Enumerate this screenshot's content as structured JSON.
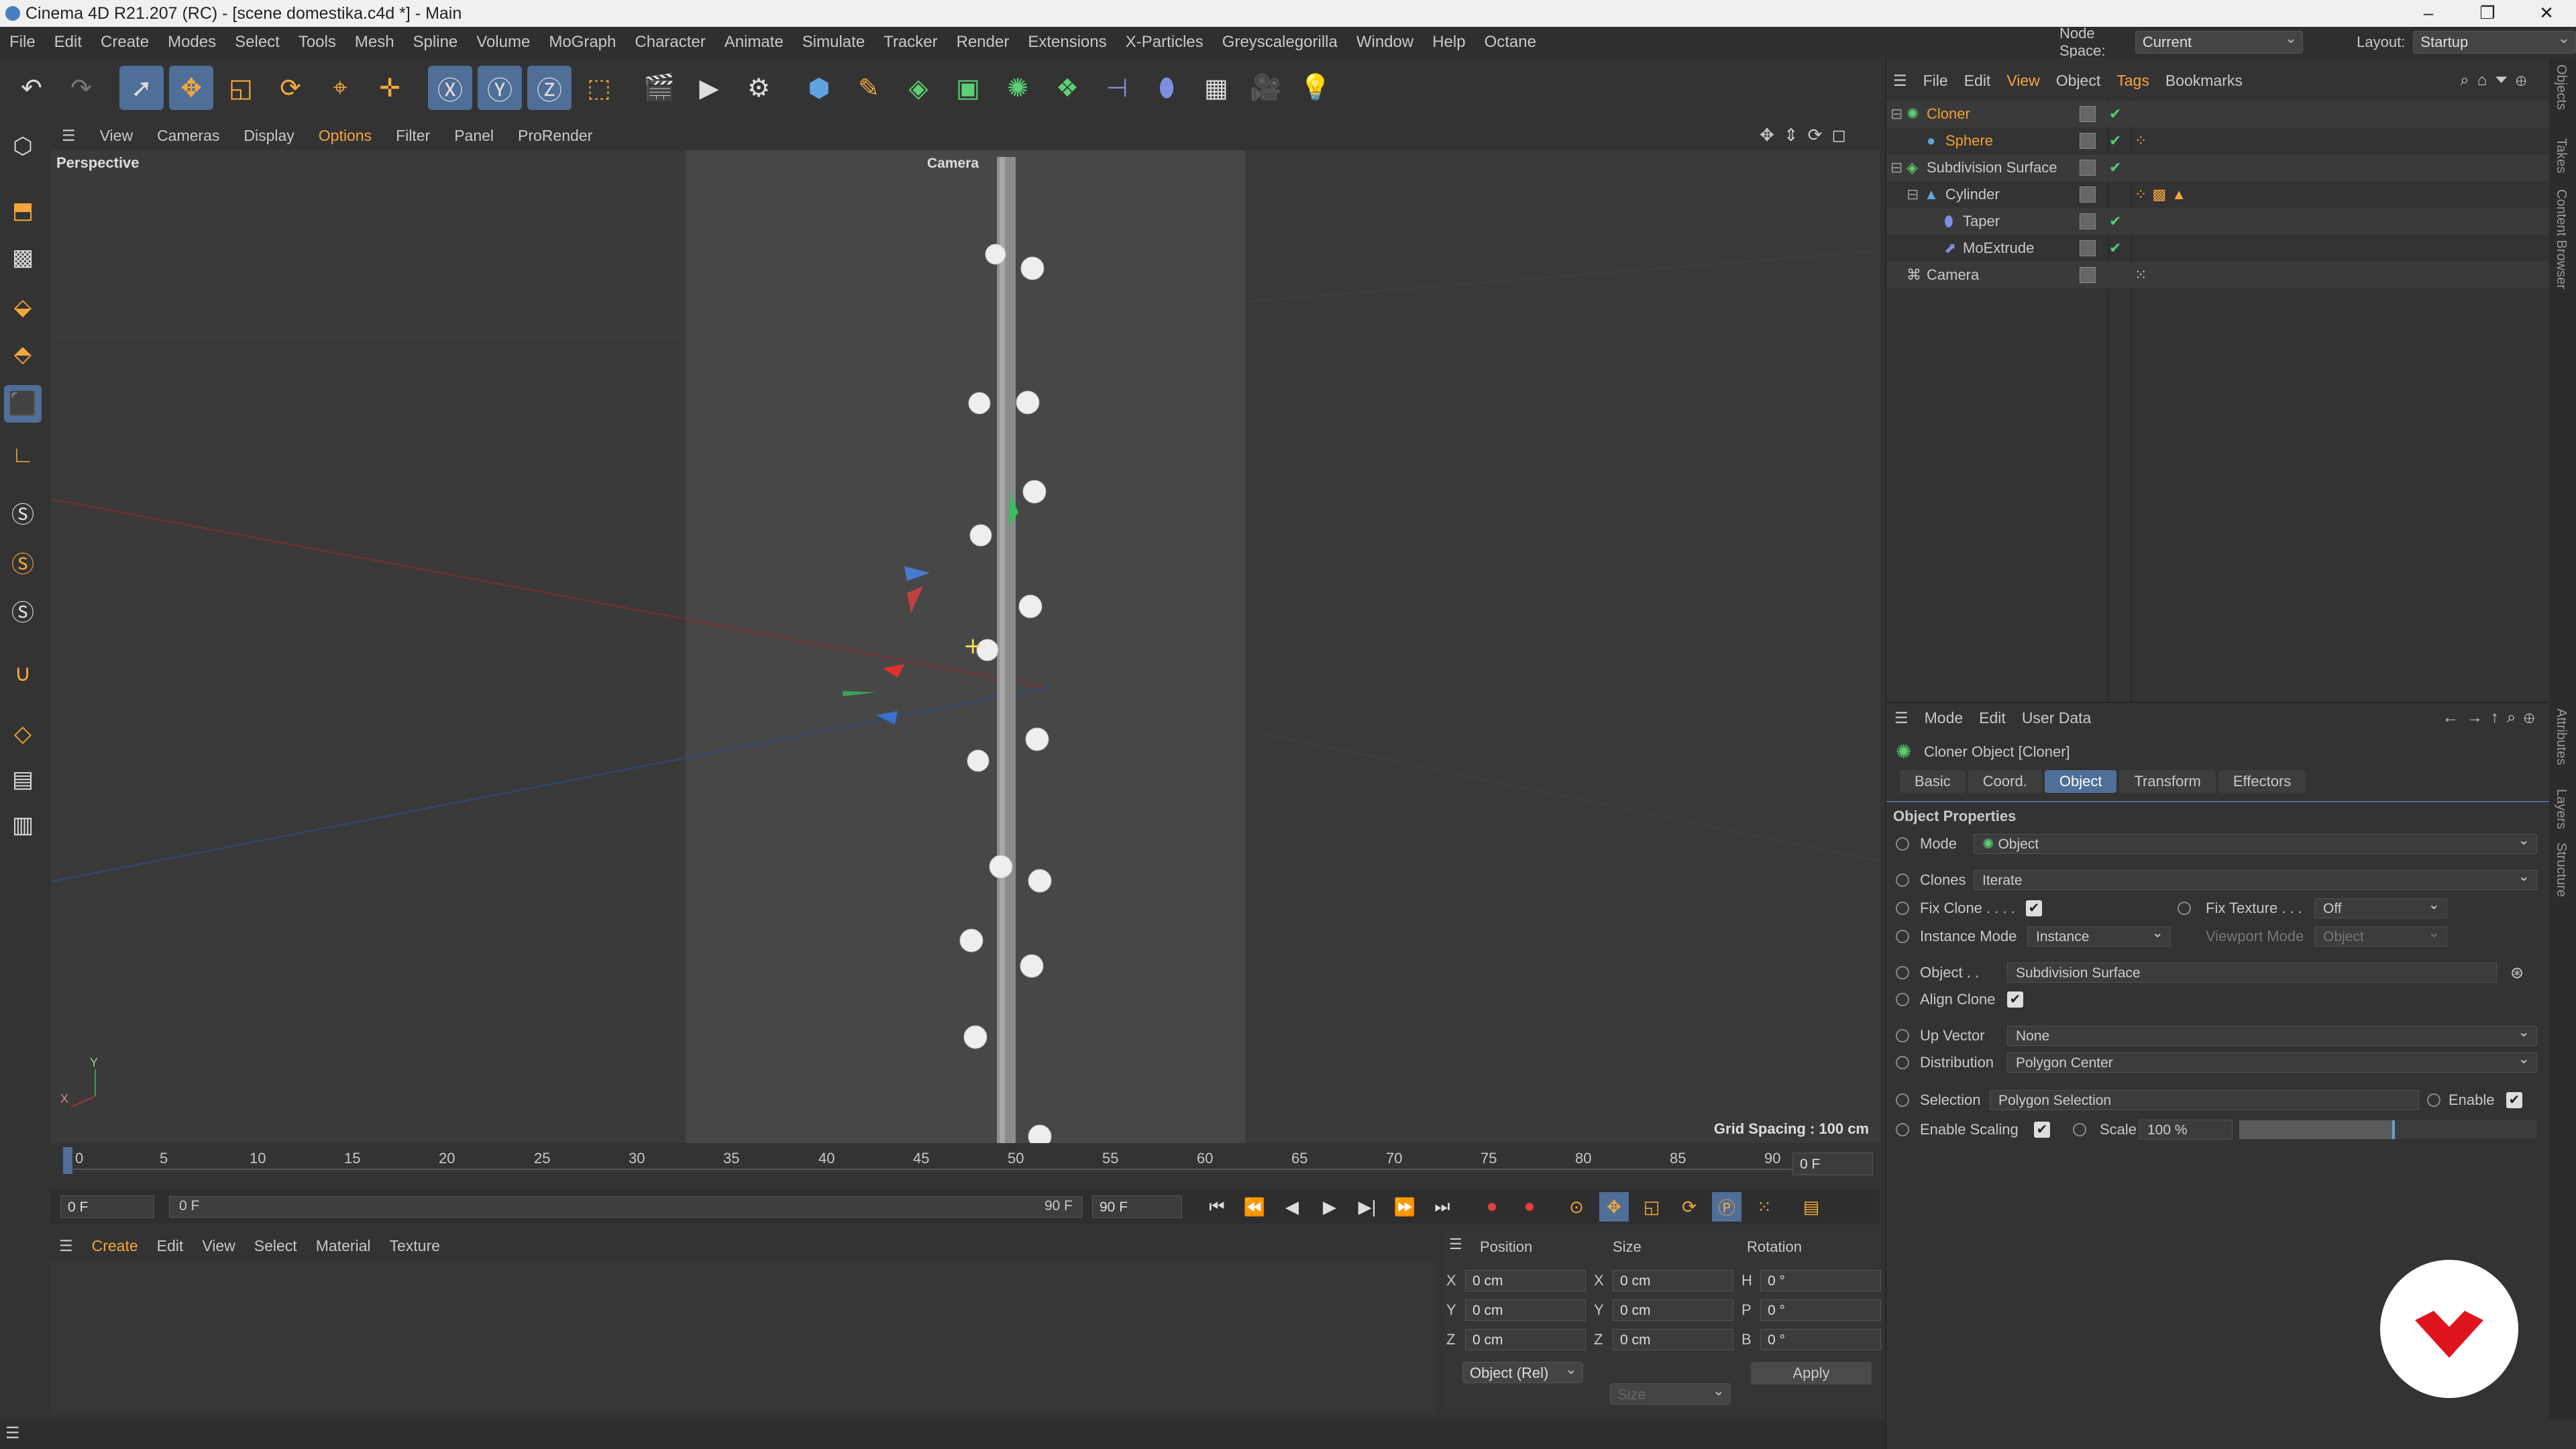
{
  "window": {
    "title": "Cinema 4D R21.207 (RC) - [scene domestika.c4d *] - Main",
    "controls": [
      "–",
      "❐",
      "✕"
    ]
  },
  "menubar": {
    "items": [
      "File",
      "Edit",
      "Create",
      "Modes",
      "Select",
      "Tools",
      "Mesh",
      "Spline",
      "Volume",
      "MoGraph",
      "Character",
      "Animate",
      "Simulate",
      "Tracker",
      "Render",
      "Extensions",
      "X-Particles",
      "Greyscalegorilla",
      "Window",
      "Help",
      "Octane"
    ]
  },
  "header_right": {
    "node_space_label": "Node Space:",
    "node_space_value": "Current (Standard/Physical)",
    "layout_label": "Layout:",
    "layout_value": "Startup"
  },
  "viewport": {
    "menu": [
      "View",
      "Cameras",
      "Display",
      "Options",
      "Filter",
      "Panel",
      "ProRender"
    ],
    "label": "Perspective",
    "camera_label": "Camera",
    "grid_spacing": "Grid Spacing : 100 cm",
    "axis_y": "Y",
    "axis_x": "X"
  },
  "timeline": {
    "ticks": [
      "0",
      "5",
      "10",
      "15",
      "20",
      "25",
      "30",
      "35",
      "40",
      "45",
      "50",
      "55",
      "60",
      "65",
      "70",
      "75",
      "80",
      "85",
      "90"
    ],
    "current_frame_field": "0 F",
    "start_field": "0 F",
    "range_start": "0 F",
    "range_end": "90 F",
    "end_field": "90 F"
  },
  "material_manager": {
    "menu": [
      "Create",
      "Edit",
      "View",
      "Select",
      "Material",
      "Texture"
    ]
  },
  "coordinates": {
    "headers": [
      "Position",
      "Size",
      "Rotation"
    ],
    "rows": [
      {
        "axis": "X",
        "pos": "0 cm",
        "size_axis": "X",
        "size": "0 cm",
        "rot_axis": "H",
        "rot": "0 °"
      },
      {
        "axis": "Y",
        "pos": "0 cm",
        "size_axis": "Y",
        "size": "0 cm",
        "rot_axis": "P",
        "rot": "0 °"
      },
      {
        "axis": "Z",
        "pos": "0 cm",
        "size_axis": "Z",
        "size": "0 cm",
        "rot_axis": "B",
        "rot": "0 °"
      }
    ],
    "mode": "Object (Rel)",
    "size_mode": "Size",
    "apply": "Apply"
  },
  "object_manager": {
    "menu": [
      "File",
      "Edit",
      "View",
      "Object",
      "Tags",
      "Bookmarks"
    ],
    "objects": [
      {
        "name": "Cloner",
        "depth": 0,
        "color": "#f0a030"
      },
      {
        "name": "Sphere",
        "depth": 1,
        "color": "#f0a030"
      },
      {
        "name": "Subdivision Surface",
        "depth": 0,
        "color": "#c8c8c8"
      },
      {
        "name": "Cylinder",
        "depth": 1,
        "color": "#c8c8c8"
      },
      {
        "name": "Taper",
        "depth": 2,
        "color": "#c8c8c8"
      },
      {
        "name": "MoExtrude",
        "depth": 2,
        "color": "#c8c8c8"
      },
      {
        "name": "Camera",
        "depth": 0,
        "color": "#c8c8c8"
      }
    ]
  },
  "attributes": {
    "menu": [
      "Mode",
      "Edit",
      "User Data"
    ],
    "object_title": "Cloner Object [Cloner]",
    "tabs": [
      "Basic",
      "Coord.",
      "Object",
      "Transform",
      "Effectors"
    ],
    "active_tab": "Object",
    "section": "Object Properties",
    "mode_label": "Mode",
    "mode_value": "Object",
    "clones_label": "Clones",
    "clones_value": "Iterate",
    "fix_clone_label": "Fix Clone . . . .",
    "fix_texture_label": "Fix Texture . . .",
    "fix_texture_value": "Off",
    "instance_mode_label": "Instance Mode",
    "instance_mode_value": "Instance",
    "viewport_mode_label": "Viewport Mode",
    "viewport_mode_value": "Object",
    "object_label": "Object . .",
    "object_value": "Subdivision Surface",
    "align_clone_label": "Align Clone",
    "up_vector_label": "Up Vector",
    "up_vector_value": "None",
    "distribution_label": "Distribution",
    "distribution_value": "Polygon Center",
    "selection_label": "Selection",
    "selection_value": "Polygon Selection",
    "enable_label": "Enable",
    "enable_scaling_label": "Enable Scaling",
    "scale_label": "Scale",
    "scale_value": "100 %"
  },
  "side_tabs": [
    "Objects",
    "Takes",
    "Content Browser",
    "Attributes",
    "Layers",
    "Structure"
  ],
  "colors": {
    "accent": "#4f6e98",
    "object_active": "#f0a030",
    "logo_red": "#e0141e"
  }
}
